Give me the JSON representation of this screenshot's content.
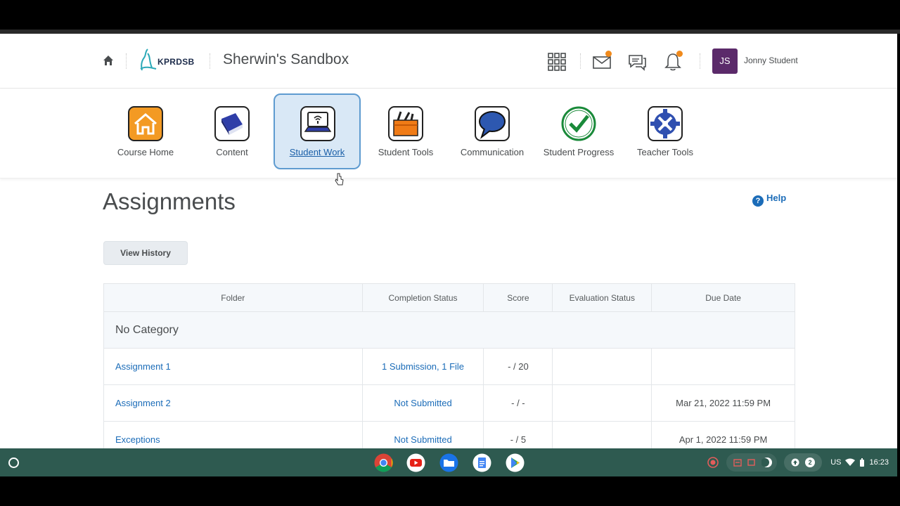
{
  "header": {
    "logo_text": "KPRDSB",
    "course_title": "Sherwin's Sandbox",
    "user_initials": "JS",
    "user_name": "Jonny Student",
    "accent": "#5b2a6a"
  },
  "nav": {
    "items": [
      {
        "label": "Course Home",
        "icon": "house-icon"
      },
      {
        "label": "Content",
        "icon": "book-icon"
      },
      {
        "label": "Student Work",
        "icon": "laptop-icon"
      },
      {
        "label": "Student Tools",
        "icon": "toolbox-icon"
      },
      {
        "label": "Communication",
        "icon": "speech-bubble-icon"
      },
      {
        "label": "Student Progress",
        "icon": "checkmark-icon"
      },
      {
        "label": "Teacher Tools",
        "icon": "gear-icon"
      }
    ],
    "active_index": 2
  },
  "page": {
    "title": "Assignments",
    "help_label": "Help",
    "view_history_label": "View History"
  },
  "table": {
    "headers": [
      "Folder",
      "Completion Status",
      "Score",
      "Evaluation Status",
      "Due Date"
    ],
    "category": "No Category",
    "rows": [
      {
        "folder": "Assignment 1",
        "completion": "1 Submission, 1 File",
        "score": "- / 20",
        "evaluation": "",
        "due": ""
      },
      {
        "folder": "Assignment 2",
        "completion": "Not Submitted",
        "score": "- / -",
        "evaluation": "",
        "due": "Mar 21, 2022 11:59 PM"
      },
      {
        "folder": "Exceptions",
        "completion": "Not Submitted",
        "score": "- / 5",
        "evaluation": "",
        "due": "Apr 1, 2022 11:59 PM"
      }
    ]
  },
  "shelf": {
    "locale": "US",
    "time": "16:23",
    "notification_count": "2"
  }
}
